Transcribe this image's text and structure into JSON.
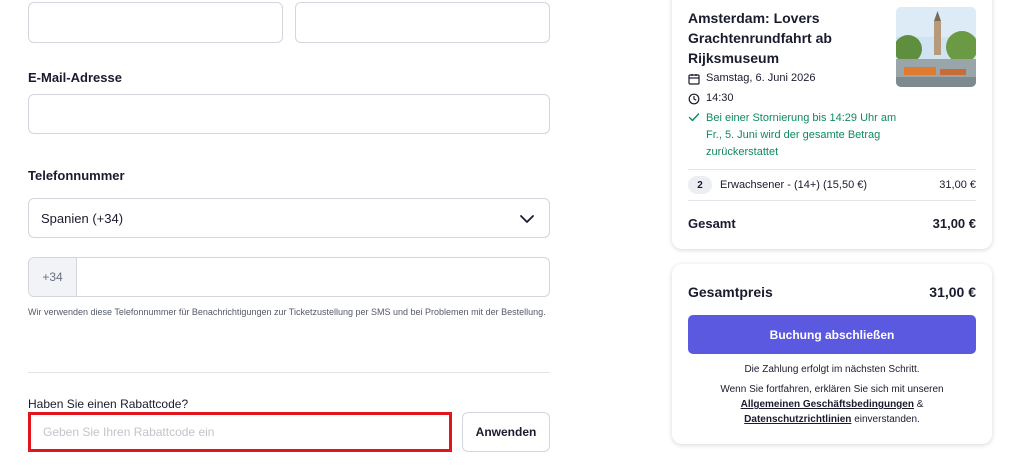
{
  "form": {
    "email_label": "E-Mail-Adresse",
    "phone_label": "Telefonnummer",
    "country_value": "Spanien (+34)",
    "phone_prefix": "+34",
    "phone_hint": "Wir verwenden diese Telefonnummer für Benachrichtigungen zur Ticketzustellung per SMS und bei Problemen mit der Bestellung.",
    "promo_label": "Haben Sie einen Rabattcode?",
    "promo_placeholder": "Geben Sie Ihren Rabattcode ein",
    "apply_label": "Anwenden"
  },
  "summary": {
    "tour_title": "Amsterdam: Lovers Grachtenrundfahrt ab Rijksmuseum",
    "date": "Samstag, 6. Juni 2026",
    "time": "14:30",
    "cancellation": "Bei einer Stornierung bis 14:29 Uhr am Fr., 5. Juni wird der gesamte Betrag zurückerstattet",
    "ticket_qty": "2",
    "ticket_label": "Erwachsener - (14+)  (15,50 €)",
    "ticket_price": "31,00 €",
    "total_label": "Gesamt",
    "total_value": "31,00 €"
  },
  "checkout": {
    "price_label": "Gesamtpreis",
    "price_value": "31,00 €",
    "book_label": "Buchung abschließen",
    "payment_note": "Die Zahlung erfolgt im nächsten Schritt.",
    "terms_prefix": "Wenn Sie fortfahren, erklären Sie sich mit unseren",
    "terms_link": "Allgemeinen Geschäftsbedingungen",
    "terms_and": "&",
    "privacy_link": "Datenschutzrichtlinien",
    "terms_suffix": "einverstanden."
  },
  "colors": {
    "accent": "#5b59e0",
    "success": "#0f8a5f",
    "highlight": "#e3141b"
  },
  "icons": [
    "calendar-icon",
    "clock-icon",
    "check-icon",
    "chevron-down-icon"
  ]
}
